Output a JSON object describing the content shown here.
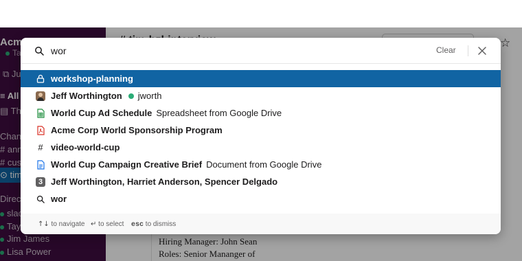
{
  "sidebar": {
    "workspace_name": "Acme",
    "user_name": "Taylor",
    "rows": [
      "Ju",
      "All u",
      "Thre",
      "Chann",
      "annc",
      "custo",
      "tim-",
      "Direct",
      "slac",
      "Taylo",
      "Jim James",
      "Lisa Power"
    ]
  },
  "channel": {
    "title": "# tim-bzl-interview",
    "card_lines": [
      "Hiring Manager: John Sean",
      "Roles: Senior Mananger of"
    ]
  },
  "search": {
    "query": "wor",
    "clear_label": "Clear"
  },
  "results": [
    {
      "icon": "lock-icon",
      "title": "workshop-planning",
      "sub": "",
      "selected": true
    },
    {
      "icon": "avatar",
      "title": "Jeff Worthington",
      "sub": "jworth",
      "online": true
    },
    {
      "icon": "google-sheets-icon",
      "title": "World Cup Ad Schedule",
      "sub": "Spreadsheet from Google Drive"
    },
    {
      "icon": "pdf-icon",
      "title": "Acme Corp World Sponsorship Program",
      "sub": ""
    },
    {
      "icon": "hash-icon",
      "title": "video-world-cup",
      "sub": ""
    },
    {
      "icon": "google-docs-icon",
      "title": "World Cup Campaign Creative Brief",
      "sub": "Document from Google Drive"
    },
    {
      "icon": "group-count-badge",
      "badge": "3",
      "title": "Jeff Worthington, Harriet Anderson, Spencer Delgado",
      "sub": ""
    },
    {
      "icon": "search-icon",
      "title": "wor",
      "sub": ""
    }
  ],
  "footer": {
    "navigate_keys": "↑↓",
    "navigate_label": "to navigate",
    "select_key": "↵",
    "select_label": "to select",
    "dismiss_key": "esc",
    "dismiss_label": "to dismiss"
  },
  "colors": {
    "sidebar": "#3f0e40",
    "selected": "#1164a3",
    "online": "#2bac76"
  }
}
